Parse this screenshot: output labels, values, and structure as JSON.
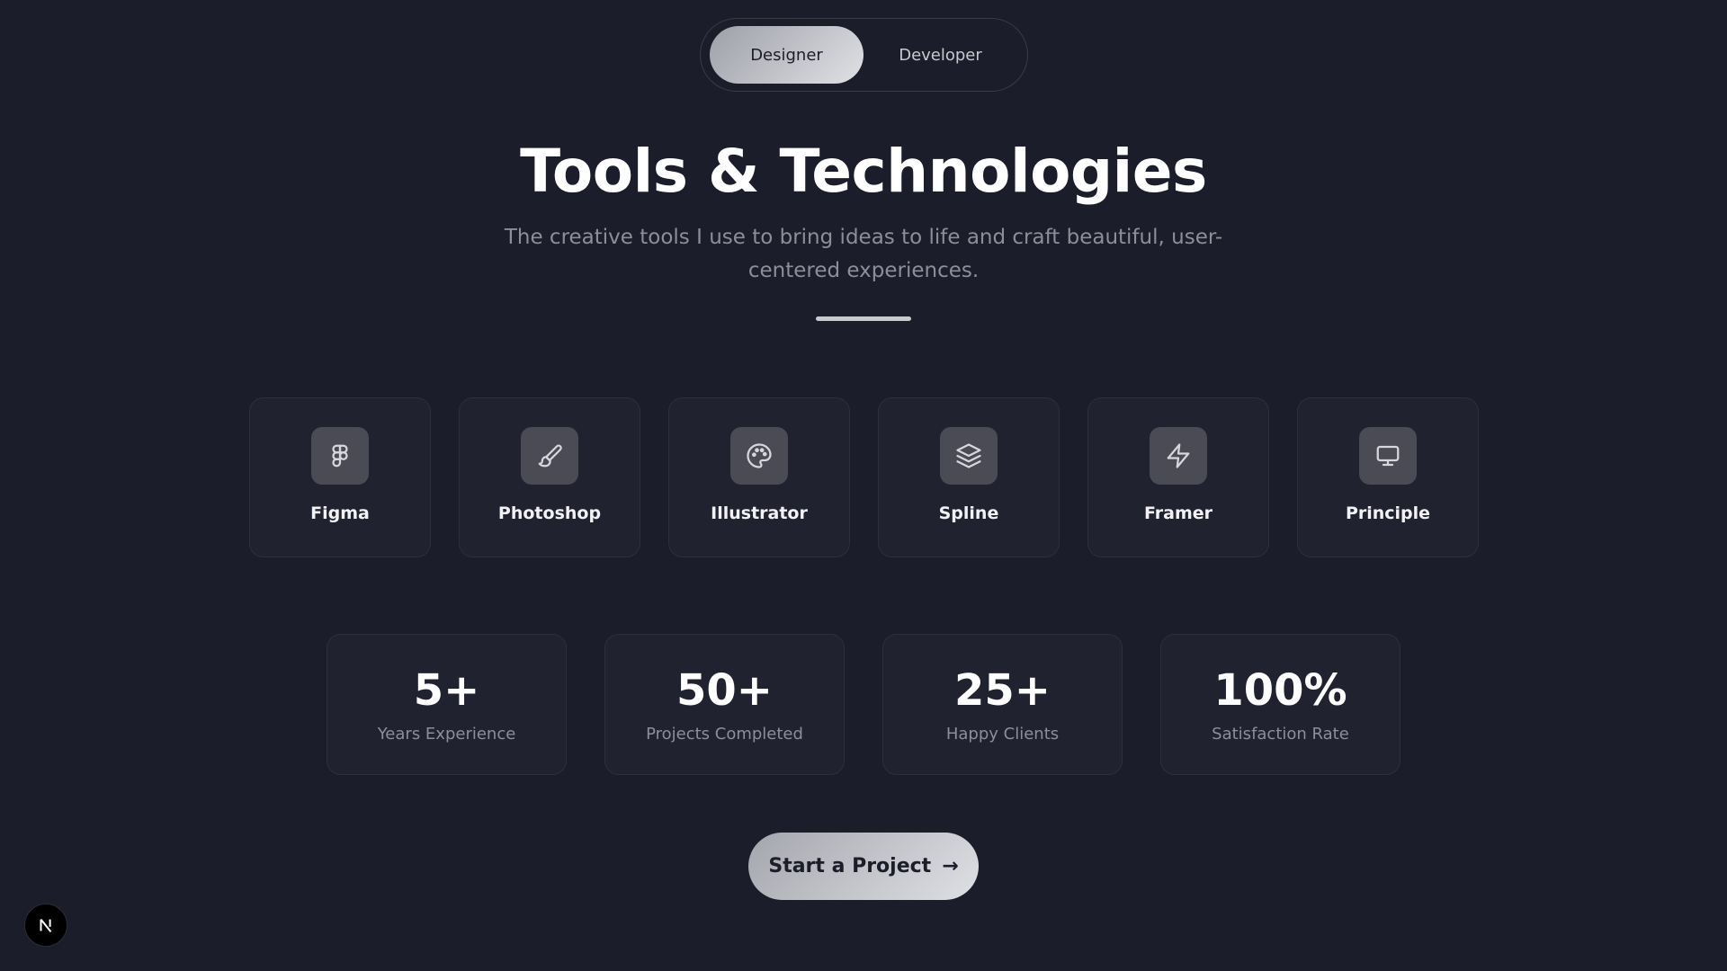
{
  "toggle": {
    "options": [
      {
        "label": "Designer",
        "active": true
      },
      {
        "label": "Developer",
        "active": false
      }
    ]
  },
  "header": {
    "title": "Tools & Technologies",
    "subtitle": "The creative tools I use to bring ideas to life and craft beautiful, user-centered experiences."
  },
  "tools": [
    {
      "name": "Figma",
      "icon": "figma-icon"
    },
    {
      "name": "Photoshop",
      "icon": "brush-icon"
    },
    {
      "name": "Illustrator",
      "icon": "palette-icon"
    },
    {
      "name": "Spline",
      "icon": "layers-icon"
    },
    {
      "name": "Framer",
      "icon": "zap-icon"
    },
    {
      "name": "Principle",
      "icon": "monitor-icon"
    }
  ],
  "stats": [
    {
      "value": "5+",
      "label": "Years Experience"
    },
    {
      "value": "50+",
      "label": "Projects Completed"
    },
    {
      "value": "25+",
      "label": "Happy Clients"
    },
    {
      "value": "100%",
      "label": "Satisfaction Rate"
    }
  ],
  "cta": {
    "label": "Start a Project",
    "arrow": "→"
  },
  "colors": {
    "background": "#1c1d2a",
    "card": "#212230",
    "muted_text": "#8d8e98",
    "accent_gradient_start": "#9ea0a8",
    "accent_gradient_end": "#e0e1e5"
  }
}
